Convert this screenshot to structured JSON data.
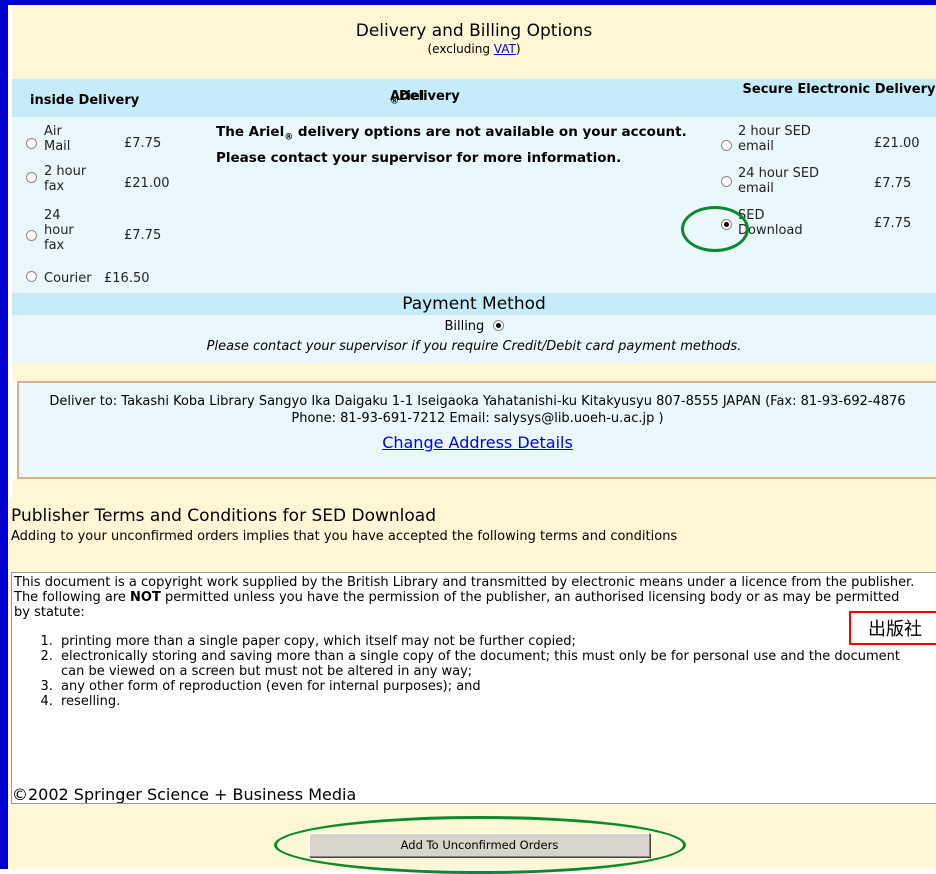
{
  "header": {
    "title": "Delivery and Billing Options",
    "sub_prefix": "(excluding ",
    "vat_link": "VAT",
    "sub_suffix": ")"
  },
  "columns": {
    "inside": "inside Delivery",
    "ariel_a": "Ariel",
    "ariel_reg": "®",
    "ariel_b": " Delivery",
    "sed": "Secure Electronic Delivery"
  },
  "inside_options": [
    {
      "label": "Air Mail",
      "price": "£7.75",
      "selected": false
    },
    {
      "label": "2 hour fax",
      "price": "£21.00",
      "selected": false
    },
    {
      "label": "24 hour fax",
      "price": "£7.75",
      "selected": false
    },
    {
      "label": "Courier",
      "price": "£16.50",
      "selected": false
    }
  ],
  "ariel_message": {
    "a": "The Ariel",
    "reg": "®",
    "b": " delivery options are not available on your account. Please contact your supervisor for more information."
  },
  "sed_options": [
    {
      "label": "2 hour SED email",
      "price": "£21.00",
      "selected": false
    },
    {
      "label": "24 hour SED email",
      "price": "£7.75",
      "selected": false
    },
    {
      "label": "SED Download",
      "price": "£7.75",
      "selected": true
    }
  ],
  "payment": {
    "title": "Payment Method",
    "billing_label": "Billing",
    "billing_selected": true,
    "note": "Please contact your supervisor if you require Credit/Debit card payment methods."
  },
  "delivery": {
    "address": "Deliver to: Takashi Koba Library Sangyo Ika Daigaku 1-1 Iseigaoka Yahatanishi-ku Kitakyusyu 807-8555 JAPAN (Fax: 81-93-692-4876 Phone: 81-93-691-7212 Email: salysys@lib.uoeh-u.ac.jp )",
    "change_link": "Change Address Details"
  },
  "terms": {
    "title": "Publisher Terms and Conditions for SED Download",
    "intro": "Adding to your unconfirmed orders implies that you have accepted the following terms and conditions",
    "para_a": "This document is a copyright work supplied by the British Library and transmitted by electronic means under a licence from the publisher. The following are ",
    "para_bold": "NOT",
    "para_b": " permitted unless you have the permission of the publisher, an authorised licensing body or as may be permitted by statute:",
    "items": [
      "printing more than a single paper copy, which itself may not be further copied;",
      "electronically storing and saving more than a single copy of the document; this must only be for personal use and the document can be viewed on a screen but must not be altered in any way;",
      "any other form of reproduction (even for internal purposes); and",
      "reselling."
    ],
    "copyright": "©2002 Springer Science + Business Media"
  },
  "annotation_badge": "出版社",
  "submit_button": "Add To Unconfirmed Orders",
  "colors": {
    "border_blue": "#0000cc",
    "header_cream": "#fff7d6",
    "head_cyan": "#c5ecf8",
    "body_cyan": "#eaf8fc",
    "annotation_green": "#0a8a2a",
    "annotation_red": "#ff0000"
  }
}
